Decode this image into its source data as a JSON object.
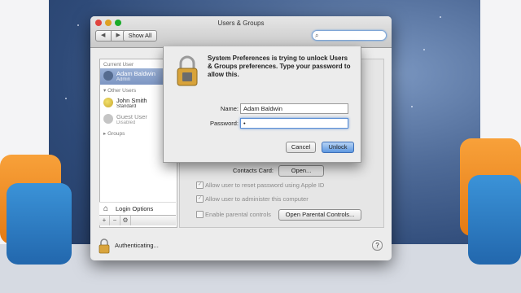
{
  "window": {
    "title": "Users & Groups",
    "back_icon": "chevron-left-icon",
    "forward_icon": "chevron-right-icon",
    "show_all_label": "Show All",
    "search_placeholder": ""
  },
  "sidebar": {
    "current_user_header": "Current User",
    "current_user": {
      "name": "Adam Baldwin",
      "role": "Admin"
    },
    "other_users_header": "Other Users",
    "other_users": [
      {
        "name": "John Smith",
        "role": "Standard"
      },
      {
        "name": "Guest User",
        "role": "Disabled"
      }
    ],
    "groups_label": "Groups",
    "login_options_label": "Login Options",
    "tools": [
      "+",
      "−",
      "⚙"
    ]
  },
  "main": {
    "contacts_card_label": "Contacts Card:",
    "open_button": "Open...",
    "allow_reset_label": "Allow user to reset password using Apple ID",
    "allow_admin_label": "Allow user to administer this computer",
    "parental_label": "Enable parental controls",
    "open_parental_button": "Open Parental Controls..."
  },
  "bottom": {
    "status_text": "Authenticating...",
    "help_label": "?"
  },
  "dialog": {
    "message": "System Preferences is trying to unlock Users & Groups preferences. Type your password to allow this.",
    "name_label": "Name:",
    "name_value": "Adam Baldwin",
    "password_label": "Password:",
    "password_value": "•",
    "cancel_button": "Cancel",
    "unlock_button": "Unlock"
  }
}
